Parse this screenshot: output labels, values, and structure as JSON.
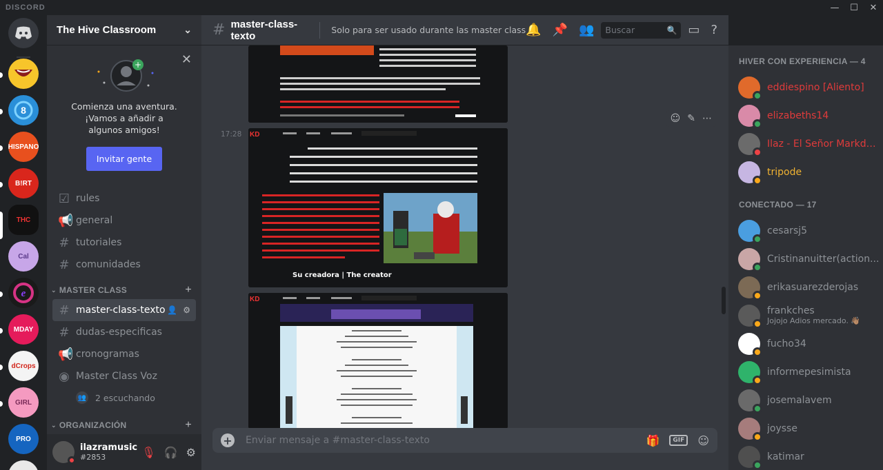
{
  "window": {
    "brand": "DISCORD"
  },
  "guild": {
    "name": "The Hive Classroom"
  },
  "invite": {
    "line1": "Comienza una aventura.",
    "line2": "¡Vamos a añadir a algunos amigos!",
    "button": "Invitar gente"
  },
  "channels": {
    "top": [
      "rules",
      "general",
      "tutoriales",
      "comunidades"
    ],
    "category1": "MASTER CLASS",
    "cat1_items": [
      "master-class-texto",
      "dudas-especificas",
      "cronogramas",
      "Master Class Voz"
    ],
    "listening": "2 escuchando",
    "category2": "ORGANIZACIÓN"
  },
  "user": {
    "name": "ilazramusic",
    "tag": "#2853"
  },
  "header": {
    "channel": "master-class-texto",
    "topic": "Solo para ser usado durante las master class",
    "search_placeholder": "Buscar"
  },
  "messages": {
    "timestamp": "17:28",
    "embed2_caption": "Su creadora | The creator"
  },
  "composer": {
    "placeholder": "Enviar mensaje a #master-class-texto",
    "gif": "GIF"
  },
  "members": {
    "group1": "HIVER CON EXPERIENCIA — 4",
    "group1_list": [
      {
        "name": "eddiespino [Aliento]",
        "color": "#e03b3b"
      },
      {
        "name": "elizabeths14",
        "color": "#e03b3b"
      },
      {
        "name": "Ilaz - El Señor Markdo...",
        "color": "#e03b3b"
      },
      {
        "name": "tripode",
        "color": "#f0b232"
      }
    ],
    "group2": "CONECTADO — 17",
    "group2_list": [
      {
        "name": "cesarsj5",
        "activity": ""
      },
      {
        "name": "Cristinanuitter(action...",
        "activity": ""
      },
      {
        "name": "erikasuarezderojas",
        "activity": ""
      },
      {
        "name": "frankches",
        "activity": "Jojojo Adios mercado. 👋🏽"
      },
      {
        "name": "fucho34",
        "activity": ""
      },
      {
        "name": "informepesimista",
        "activity": ""
      },
      {
        "name": "josemalavem",
        "activity": ""
      },
      {
        "name": "joysse",
        "activity": ""
      },
      {
        "name": "katimar",
        "activity": ""
      }
    ]
  },
  "colors": {
    "accent": "#5865f2",
    "online": "#3ba55d",
    "idle": "#faa81a",
    "dnd": "#ed4245"
  }
}
